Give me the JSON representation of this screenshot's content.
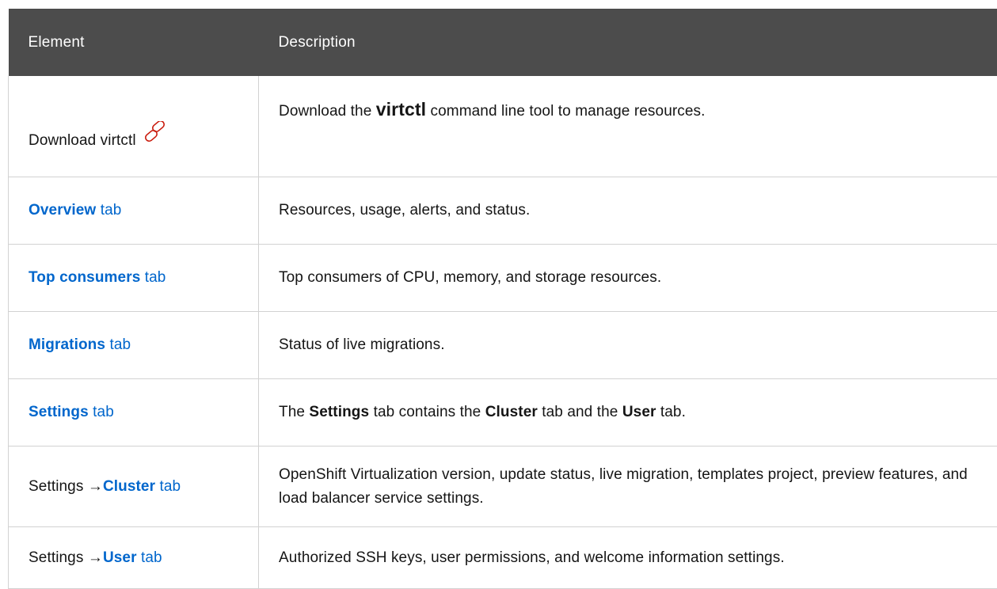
{
  "table": {
    "headers": {
      "element": "Element",
      "description": "Description"
    },
    "rows": [
      {
        "element_text": "Download virtctl",
        "icon": "link-icon",
        "desc_prefix": "Download the ",
        "desc_code": "virtctl",
        "desc_suffix": " command line tool to manage resources."
      },
      {
        "element_link": "Overview",
        "element_suffix": " tab",
        "description": "Resources, usage, alerts, and status."
      },
      {
        "element_link": "Top consumers",
        "element_suffix": " tab",
        "description": "Top consumers of CPU, memory, and storage resources."
      },
      {
        "element_link": "Migrations",
        "element_suffix": " tab",
        "description": "Status of live migrations."
      },
      {
        "element_link": "Settings",
        "element_suffix": " tab",
        "desc_parts": [
          "The ",
          "Settings",
          " tab contains the ",
          "Cluster",
          " tab and the ",
          "User",
          " tab."
        ]
      },
      {
        "element_prefix": "Settings →",
        "element_link": "Cluster",
        "element_suffix": " tab",
        "description": "OpenShift Virtualization version, update status, live migration, templates project, preview features, and load balancer service settings."
      },
      {
        "element_prefix": "Settings →",
        "element_link": "User",
        "element_suffix": " tab",
        "description": "Authorized SSH keys, user permissions, and welcome information settings."
      }
    ]
  },
  "colors": {
    "header_bg": "#4c4c4c",
    "link": "#0066cc",
    "icon": "#c9190b",
    "border": "#d2d2d2"
  }
}
